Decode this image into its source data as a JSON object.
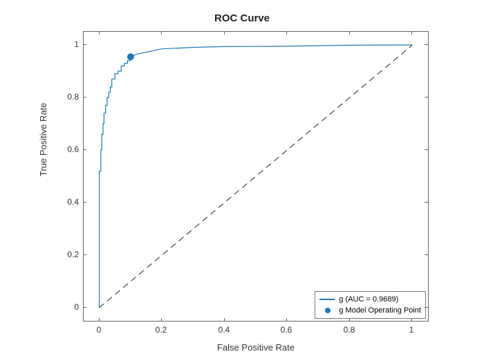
{
  "chart_data": {
    "type": "line",
    "title": "ROC Curve",
    "xlabel": "False Positive Rate",
    "ylabel": "True Positive Rate",
    "xlim": [
      -0.05,
      1.05
    ],
    "ylim": [
      -0.05,
      1.05
    ],
    "x_ticks": [
      0,
      0.2,
      0.4,
      0.6,
      0.8,
      1
    ],
    "y_ticks": [
      0,
      0.2,
      0.4,
      0.6,
      0.8,
      1
    ],
    "series": [
      {
        "name": "g (AUC = 0.9689)",
        "x": [
          0,
          0,
          0.005,
          0.005,
          0.008,
          0.008,
          0.012,
          0.012,
          0.015,
          0.015,
          0.02,
          0.02,
          0.025,
          0.025,
          0.03,
          0.03,
          0.035,
          0.035,
          0.04,
          0.04,
          0.05,
          0.05,
          0.06,
          0.06,
          0.07,
          0.07,
          0.08,
          0.08,
          0.09,
          0.09,
          0.1,
          0.1,
          0.12,
          0.12,
          0.14,
          0.16,
          0.18,
          0.2,
          0.25,
          0.3,
          0.4,
          0.6,
          0.8,
          1.0
        ],
        "y": [
          0,
          0.52,
          0.52,
          0.6,
          0.6,
          0.66,
          0.66,
          0.7,
          0.7,
          0.74,
          0.74,
          0.77,
          0.77,
          0.8,
          0.8,
          0.82,
          0.82,
          0.84,
          0.84,
          0.87,
          0.87,
          0.89,
          0.89,
          0.9,
          0.9,
          0.92,
          0.92,
          0.93,
          0.93,
          0.94,
          0.94,
          0.955,
          0.965,
          0.97,
          0.975,
          0.98,
          0.985,
          0.99,
          0.993,
          0.995,
          0.998,
          0.999,
          1.0,
          1.0
        ]
      },
      {
        "name": "g Model Operating Point",
        "type": "marker",
        "x": [
          0.1
        ],
        "y": [
          0.955
        ]
      },
      {
        "name": "diagonal",
        "type": "diagonal",
        "x": [
          0,
          1
        ],
        "y": [
          0,
          1
        ]
      }
    ],
    "legend": {
      "position": "lower right",
      "entries": [
        "g (AUC = 0.9689)",
        "g Model Operating Point"
      ]
    },
    "auc": 0.9689
  }
}
